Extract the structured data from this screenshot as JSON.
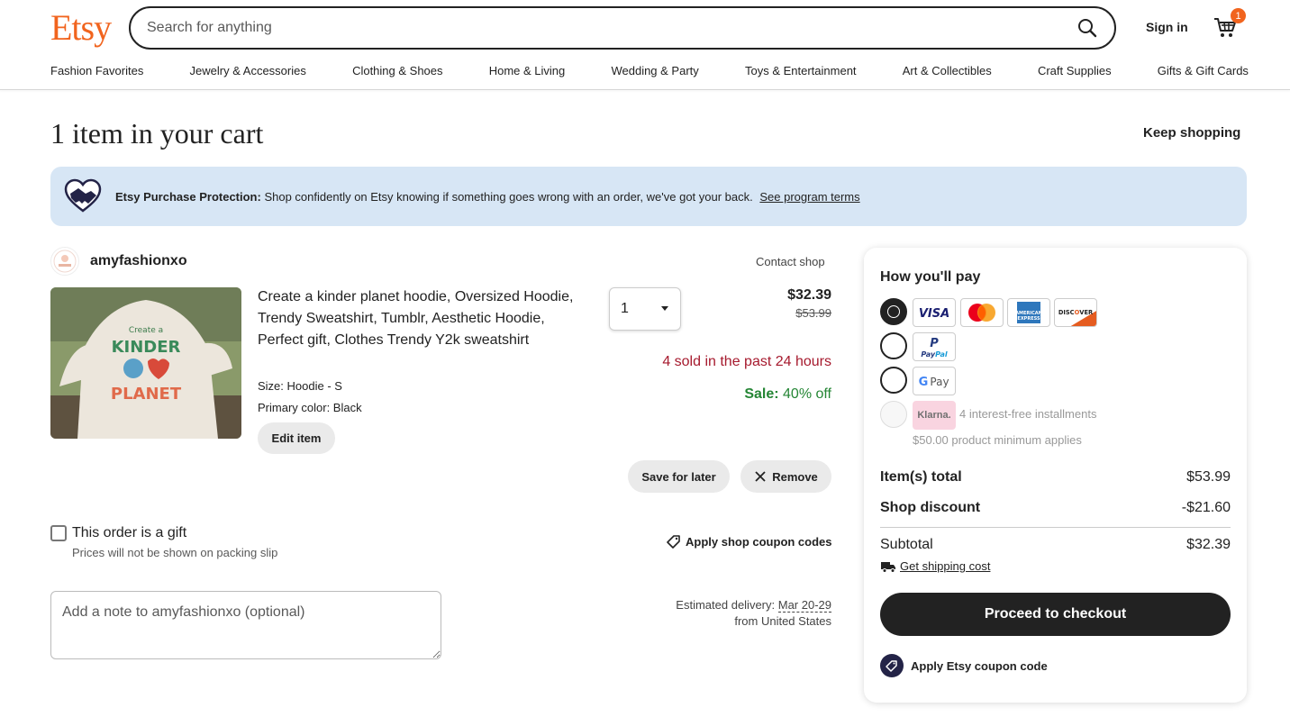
{
  "header": {
    "logo": "Etsy",
    "search_placeholder": "Search for anything",
    "sign_in": "Sign in",
    "cart_count": "1"
  },
  "nav": [
    "Fashion Favorites",
    "Jewelry & Accessories",
    "Clothing & Shoes",
    "Home & Living",
    "Wedding & Party",
    "Toys & Entertainment",
    "Art & Collectibles",
    "Craft Supplies",
    "Gifts & Gift Cards"
  ],
  "page": {
    "title": "1 item in your cart",
    "keep_shopping": "Keep shopping"
  },
  "banner": {
    "bold": "Etsy Purchase Protection:",
    "text": "Shop confidently on Etsy knowing if something goes wrong with an order, we've got your back.",
    "link": "See program terms"
  },
  "shop": {
    "name": "amyfashionxo",
    "contact": "Contact shop"
  },
  "item": {
    "title": "Create a kinder planet hoodie, Oversized Hoodie, Trendy Sweatshirt, Tumblr, Aesthetic Hoodie, Perfect gift, Clothes Trendy Y2k sweatshirt",
    "size": "Size: Hoodie - S",
    "color": "Primary color: Black",
    "edit": "Edit item",
    "quantity": "1",
    "price": "$32.39",
    "old_price": "$53.99",
    "sold": "4 sold in the past 24 hours",
    "sale_label": "Sale:",
    "sale_value": "40% off",
    "save_for_later": "Save for later",
    "remove": "Remove"
  },
  "gift": {
    "label": "This order is a gift",
    "sub": "Prices will not be shown on packing slip"
  },
  "coupon_shop": "Apply shop coupon codes",
  "note_placeholder": "Add a note to amyfashionxo (optional)",
  "delivery": {
    "label": "Estimated delivery:",
    "dates": "Mar 20-29",
    "from": "from United States"
  },
  "payment": {
    "title": "How you'll pay",
    "klarna_label": "Klarna.",
    "klarna_text": "4 interest-free installments",
    "klarna_sub": "$50.00 product minimum applies",
    "cards": [
      "VISA",
      "Mastercard",
      "American Express",
      "DISCOVER"
    ],
    "paypal": "PayPal",
    "gpay": "G Pay",
    "items_total_label": "Item(s) total",
    "items_total": "$53.99",
    "discount_label": "Shop discount",
    "discount": "-$21.60",
    "subtotal_label": "Subtotal",
    "subtotal": "$32.39",
    "shipping_link": "Get shipping cost",
    "checkout": "Proceed to checkout",
    "etsy_coupon": "Apply Etsy coupon code"
  },
  "colors": {
    "brand": "#f1641e",
    "banner_bg": "#d7e6f5",
    "sold_red": "#a61a2e",
    "sale_green": "#258635"
  }
}
